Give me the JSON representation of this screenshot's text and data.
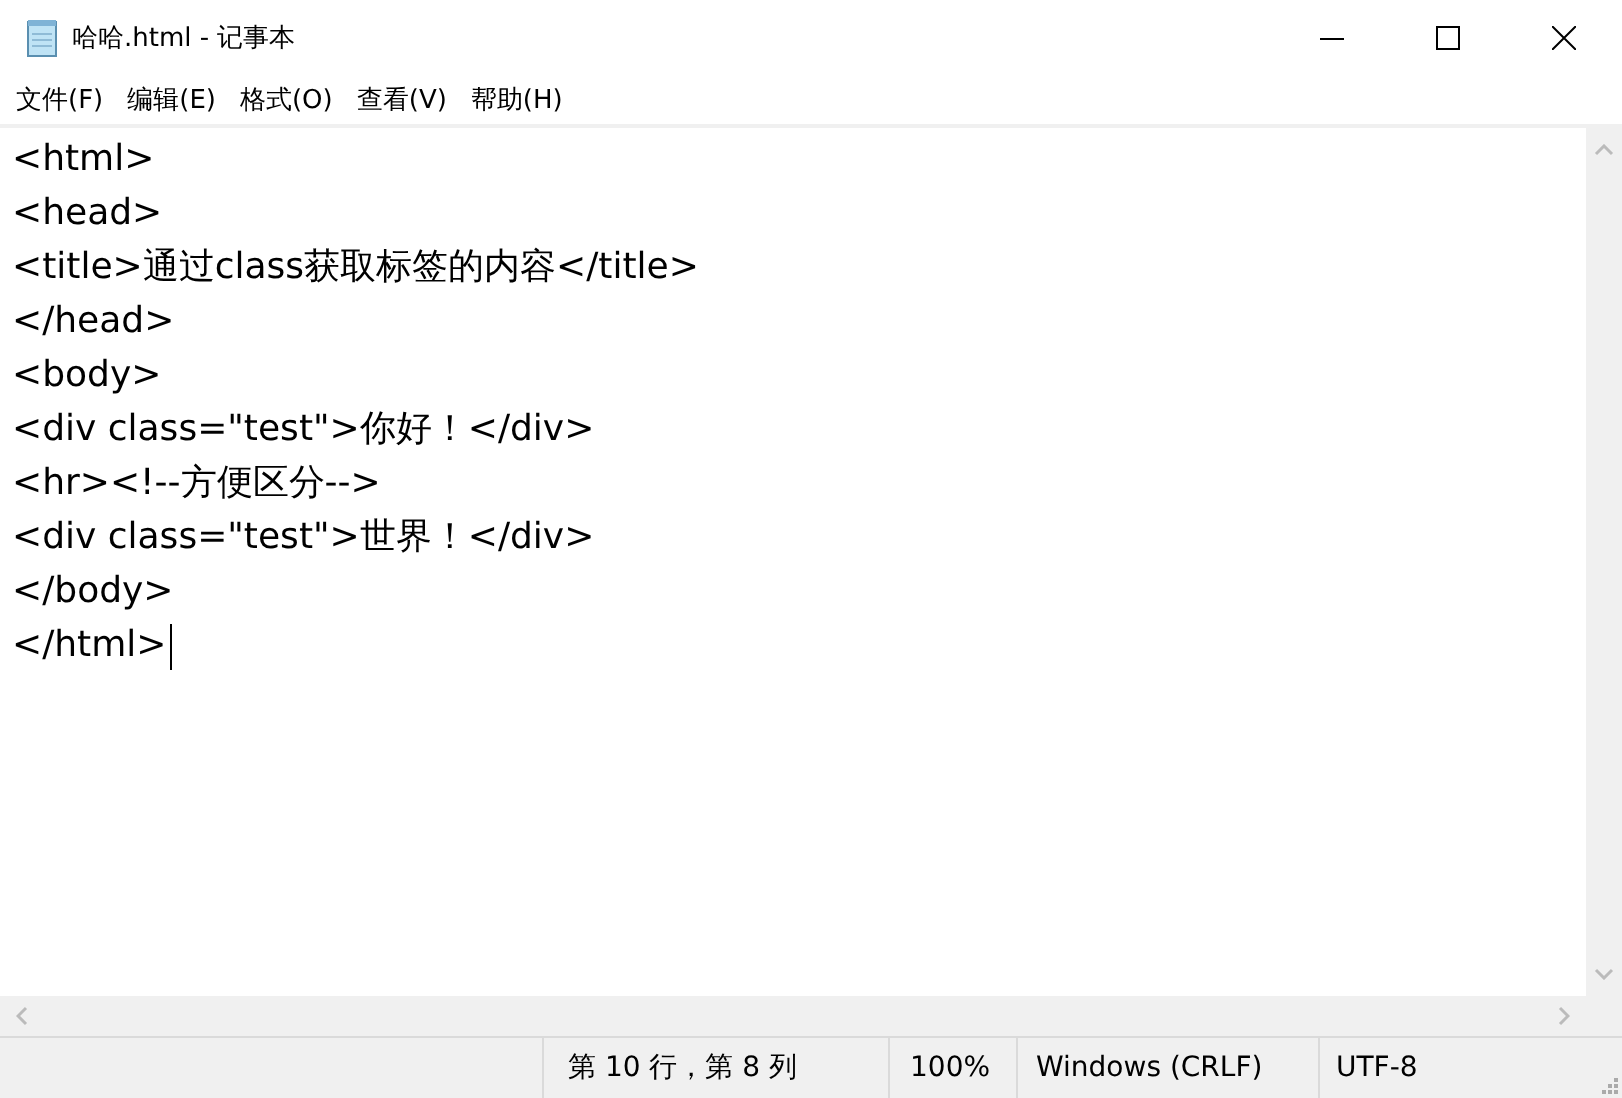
{
  "window": {
    "title": "哈哈.html - 记事本"
  },
  "menu": [
    "文件(F)",
    "编辑(E)",
    "格式(O)",
    "查看(V)",
    "帮助(H)"
  ],
  "editor": {
    "lines": [
      "<html>",
      "<head>",
      "<title>通过class获取标签的内容</title>",
      "</head>",
      "<body>",
      "<div class=\"test\">你好！</div>",
      "<hr><!--方便区分-->",
      "<div class=\"test\">世界！</div>",
      "</body>",
      "</html>"
    ]
  },
  "status_bar": {
    "position": "第 10 行，第 8 列",
    "zoom": "100%",
    "line_ending": "Windows (CRLF)",
    "encoding": "UTF-8"
  }
}
